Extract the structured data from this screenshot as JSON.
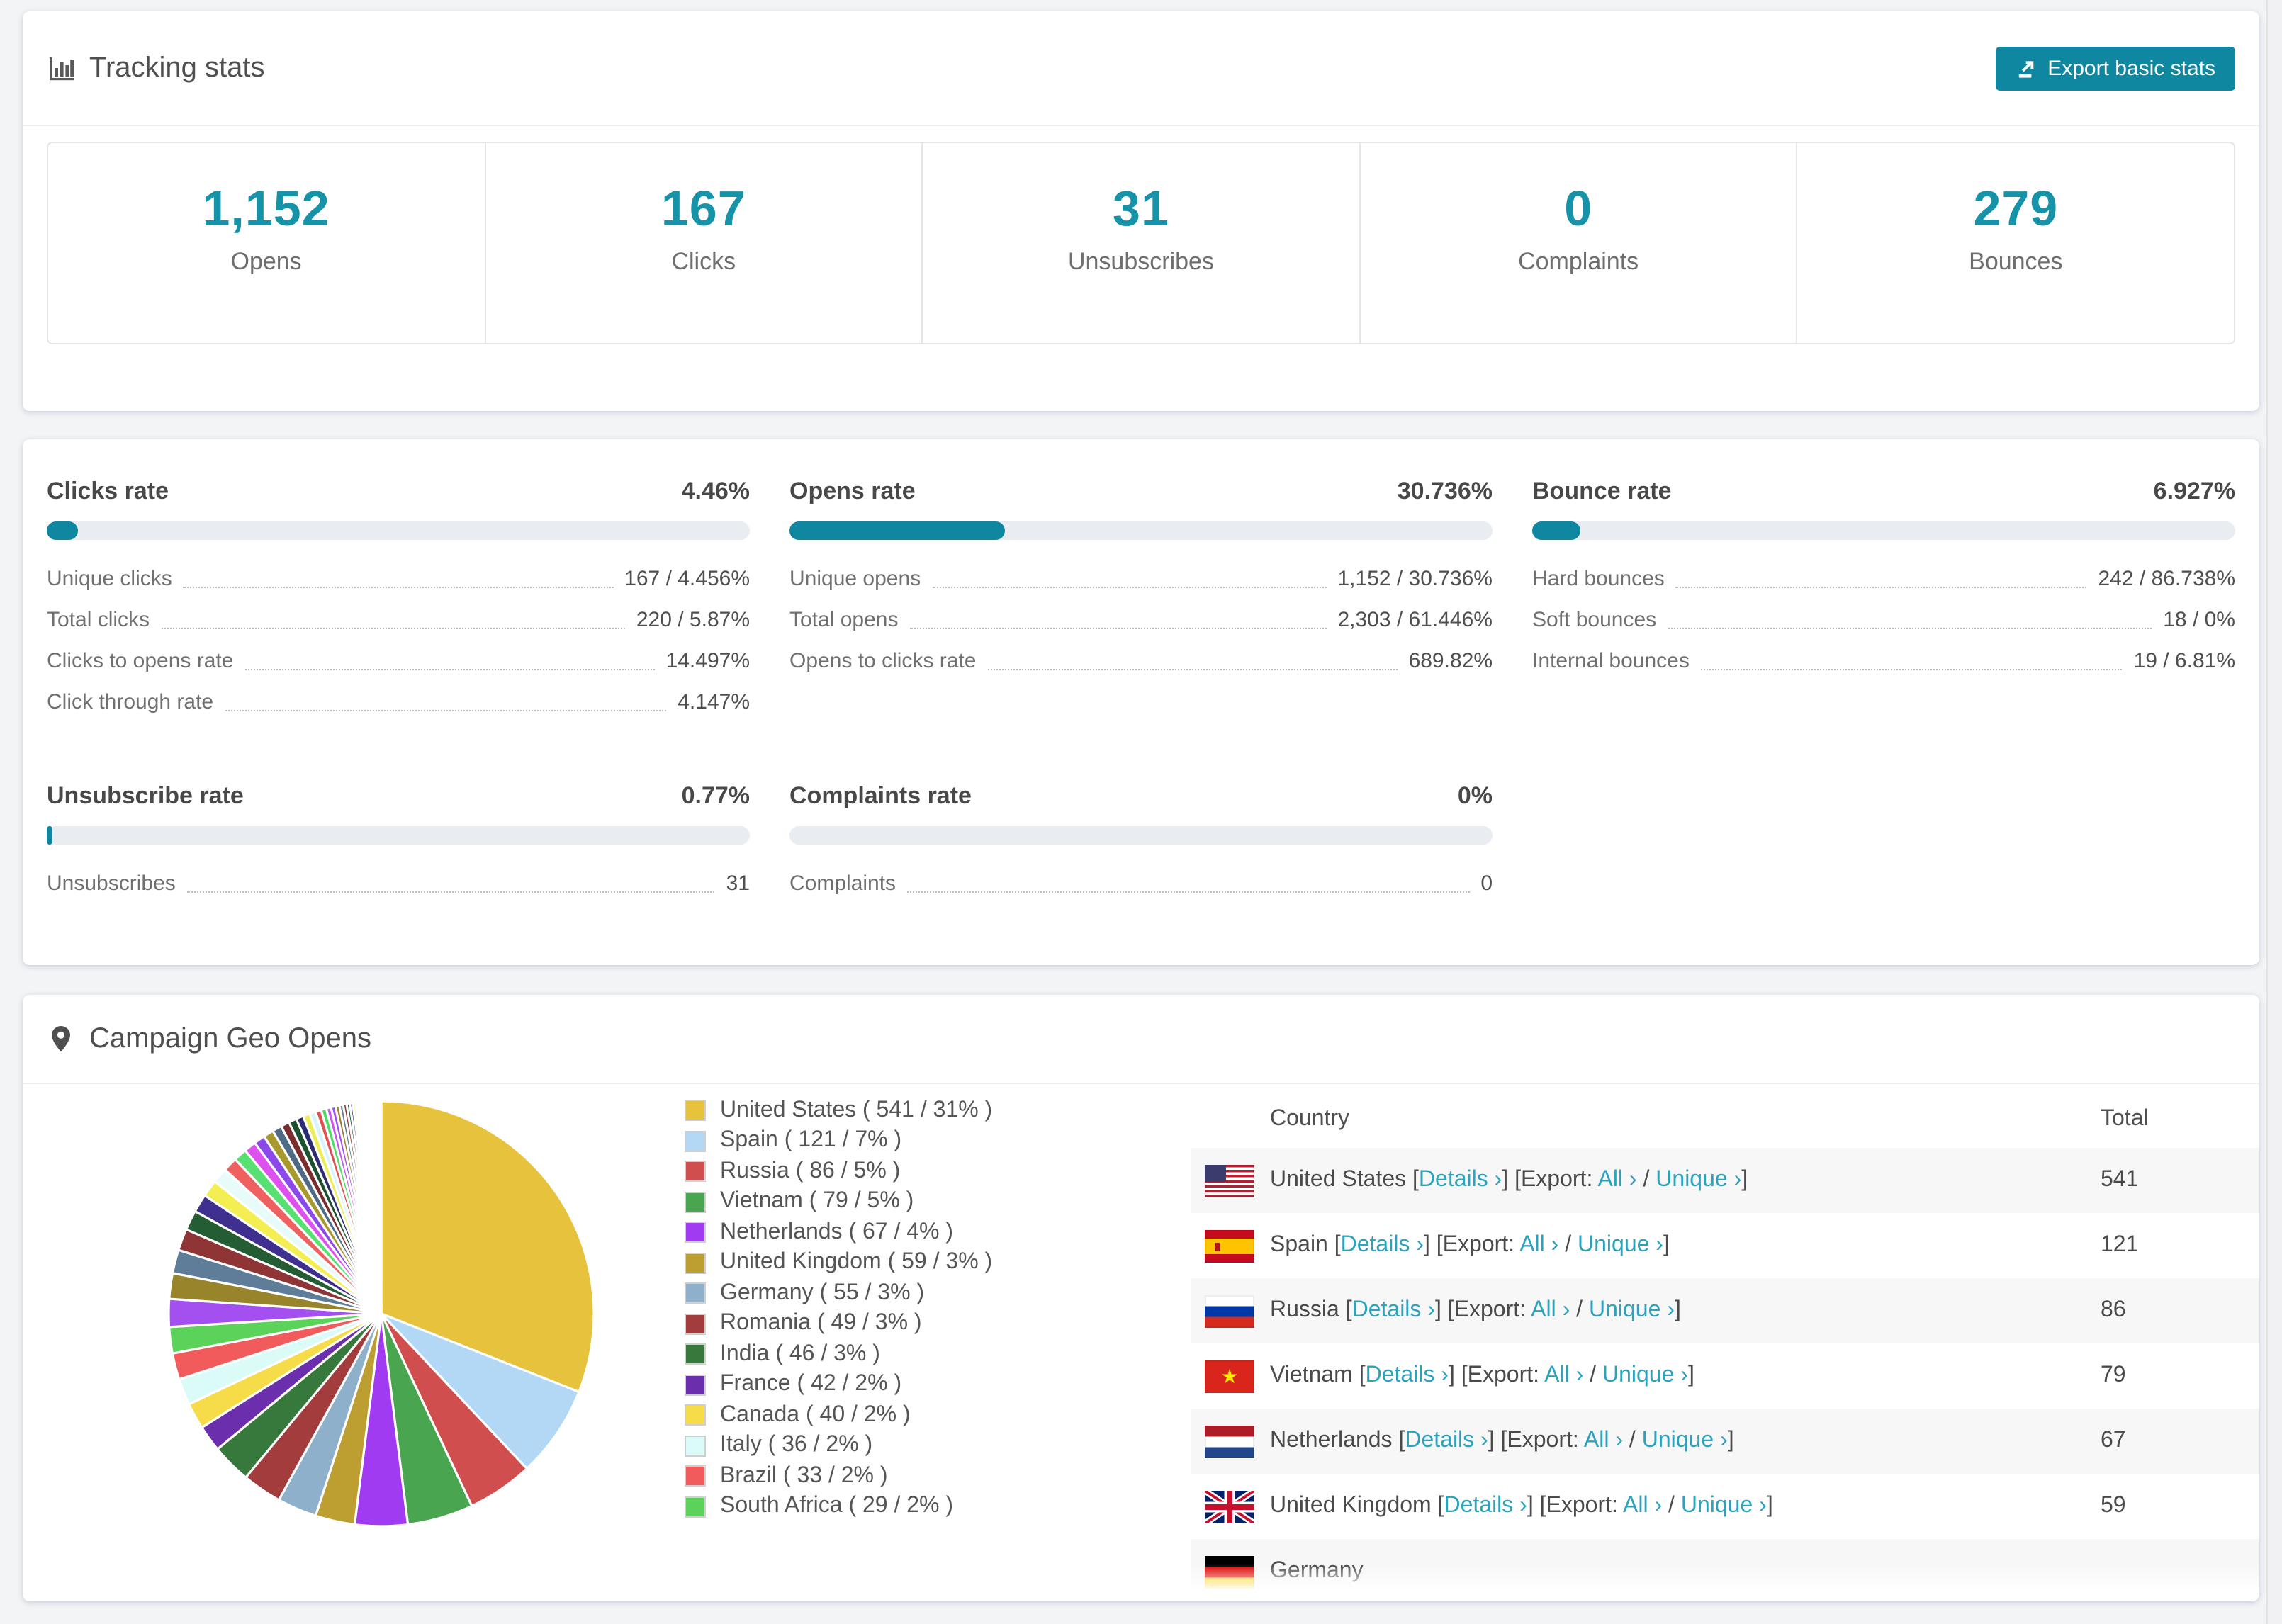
{
  "colors": {
    "accent_number": "#1793a9",
    "accent_button": "#0f87a0",
    "accent_link": "#2ba3bd",
    "bar_fill": "#0f87a0",
    "bar_track": "#e9ecf0",
    "row_stripe": "#f7f7f8"
  },
  "icons": {
    "header": "bar-chart-icon",
    "geo": "map-pin-icon",
    "export": "export-icon"
  },
  "tracking": {
    "title": "Tracking stats",
    "export_button": "Export basic stats",
    "stats": [
      {
        "value": "1,152",
        "label": "Opens"
      },
      {
        "value": "167",
        "label": "Clicks"
      },
      {
        "value": "31",
        "label": "Unsubscribes"
      },
      {
        "value": "0",
        "label": "Complaints"
      },
      {
        "value": "279",
        "label": "Bounces"
      }
    ]
  },
  "rates": {
    "blocks": [
      {
        "title": "Clicks rate",
        "value": "4.46%",
        "percent": 4.46,
        "rows": [
          {
            "label": "Unique clicks",
            "value": "167 / 4.456%"
          },
          {
            "label": "Total clicks",
            "value": "220 / 5.87%"
          },
          {
            "label": "Clicks to opens rate",
            "value": "14.497%"
          },
          {
            "label": "Click through rate",
            "value": "4.147%"
          }
        ]
      },
      {
        "title": "Opens rate",
        "value": "30.736%",
        "percent": 30.736,
        "rows": [
          {
            "label": "Unique opens",
            "value": "1,152 / 30.736%"
          },
          {
            "label": "Total opens",
            "value": "2,303 / 61.446%"
          },
          {
            "label": "Opens to clicks rate",
            "value": "689.82%"
          }
        ]
      },
      {
        "title": "Bounce rate",
        "value": "6.927%",
        "percent": 6.927,
        "rows": [
          {
            "label": "Hard bounces",
            "value": "242 / 86.738%"
          },
          {
            "label": "Soft bounces",
            "value": "18 / 0%"
          },
          {
            "label": "Internal bounces",
            "value": "19 / 6.81%"
          }
        ]
      },
      {
        "title": "Unsubscribe rate",
        "value": "0.77%",
        "percent": 0.77,
        "rows": [
          {
            "label": "Unsubscribes",
            "value": "31"
          }
        ]
      },
      {
        "title": "Complaints rate",
        "value": "0%",
        "percent": 0,
        "rows": [
          {
            "label": "Complaints",
            "value": "0"
          }
        ]
      }
    ]
  },
  "geo": {
    "title": "Campaign Geo Opens",
    "chart_data": {
      "type": "pie",
      "title": "Campaign Geo Opens",
      "start_angle": "top",
      "direction": "clockwise",
      "legend_position": "right",
      "series": [
        {
          "name": "United States",
          "value": 541,
          "percent": 31,
          "color": "#e6c23d"
        },
        {
          "name": "Spain",
          "value": 121,
          "percent": 7,
          "color": "#b3d8f5"
        },
        {
          "name": "Russia",
          "value": 86,
          "percent": 5,
          "color": "#d04e4e"
        },
        {
          "name": "Vietnam",
          "value": 79,
          "percent": 5,
          "color": "#4aa550"
        },
        {
          "name": "Netherlands",
          "value": 67,
          "percent": 4,
          "color": "#a13bf2"
        },
        {
          "name": "United Kingdom",
          "value": 59,
          "percent": 3,
          "color": "#bd9e30"
        },
        {
          "name": "Germany",
          "value": 55,
          "percent": 3,
          "color": "#8fb0cb"
        },
        {
          "name": "Romania",
          "value": 49,
          "percent": 3,
          "color": "#a33c3c"
        },
        {
          "name": "India",
          "value": 46,
          "percent": 3,
          "color": "#37793c"
        },
        {
          "name": "France",
          "value": 42,
          "percent": 2,
          "color": "#6b2fae"
        },
        {
          "name": "Canada",
          "value": 40,
          "percent": 2,
          "color": "#f6dc49"
        },
        {
          "name": "Italy",
          "value": 36,
          "percent": 2,
          "color": "#dbfbf8"
        },
        {
          "name": "Brazil",
          "value": 33,
          "percent": 2,
          "color": "#f15b5b"
        },
        {
          "name": "South Africa",
          "value": 29,
          "percent": 2,
          "color": "#5bd35b"
        }
      ],
      "others_percent": 26
    },
    "table": {
      "headers": [
        "Country",
        "Total"
      ],
      "link_labels": {
        "details": "Details ›",
        "export": "Export:",
        "all": "All ›",
        "unique": "Unique ›"
      },
      "rows": [
        {
          "country": "United States",
          "flag": "us",
          "total": "541"
        },
        {
          "country": "Spain",
          "flag": "es",
          "total": "121"
        },
        {
          "country": "Russia",
          "flag": "ru",
          "total": "86"
        },
        {
          "country": "Vietnam",
          "flag": "vn",
          "total": "79"
        },
        {
          "country": "Netherlands",
          "flag": "nl",
          "total": "67"
        },
        {
          "country": "United Kingdom",
          "flag": "gb",
          "total": "59"
        },
        {
          "country": "Germany",
          "flag": "de",
          "total": "",
          "partial": true
        }
      ]
    }
  }
}
